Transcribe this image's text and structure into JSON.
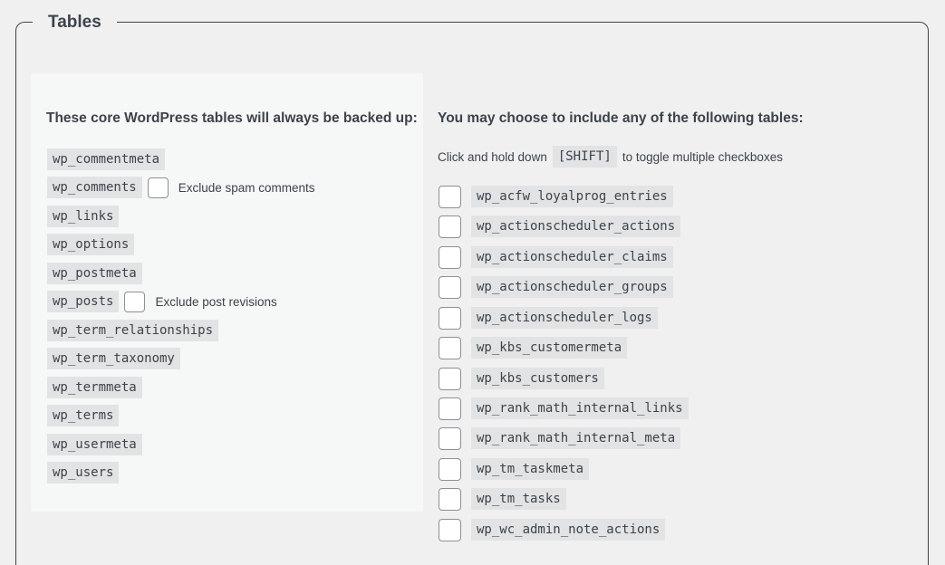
{
  "section": {
    "legend": "Tables"
  },
  "core": {
    "title": "These core WordPress tables will always be backed up:",
    "tables": [
      {
        "name": "wp_commentmeta"
      },
      {
        "name": "wp_comments",
        "exclude_label": "Exclude spam comments"
      },
      {
        "name": "wp_links"
      },
      {
        "name": "wp_options"
      },
      {
        "name": "wp_postmeta"
      },
      {
        "name": "wp_posts",
        "exclude_label": "Exclude post revisions"
      },
      {
        "name": "wp_term_relationships"
      },
      {
        "name": "wp_term_taxonomy"
      },
      {
        "name": "wp_termmeta"
      },
      {
        "name": "wp_terms"
      },
      {
        "name": "wp_usermeta"
      },
      {
        "name": "wp_users"
      }
    ]
  },
  "optional": {
    "title": "You may choose to include any of the following tables:",
    "hint_before": "Click and hold down",
    "hint_key": "[SHIFT]",
    "hint_after": "to toggle multiple checkboxes",
    "tables": [
      "wp_acfw_loyalprog_entries",
      "wp_actionscheduler_actions",
      "wp_actionscheduler_claims",
      "wp_actionscheduler_groups",
      "wp_actionscheduler_logs",
      "wp_kbs_customermeta",
      "wp_kbs_customers",
      "wp_rank_math_internal_links",
      "wp_rank_math_internal_meta",
      "wp_tm_taskmeta",
      "wp_tm_tasks",
      "wp_wc_admin_note_actions"
    ]
  }
}
